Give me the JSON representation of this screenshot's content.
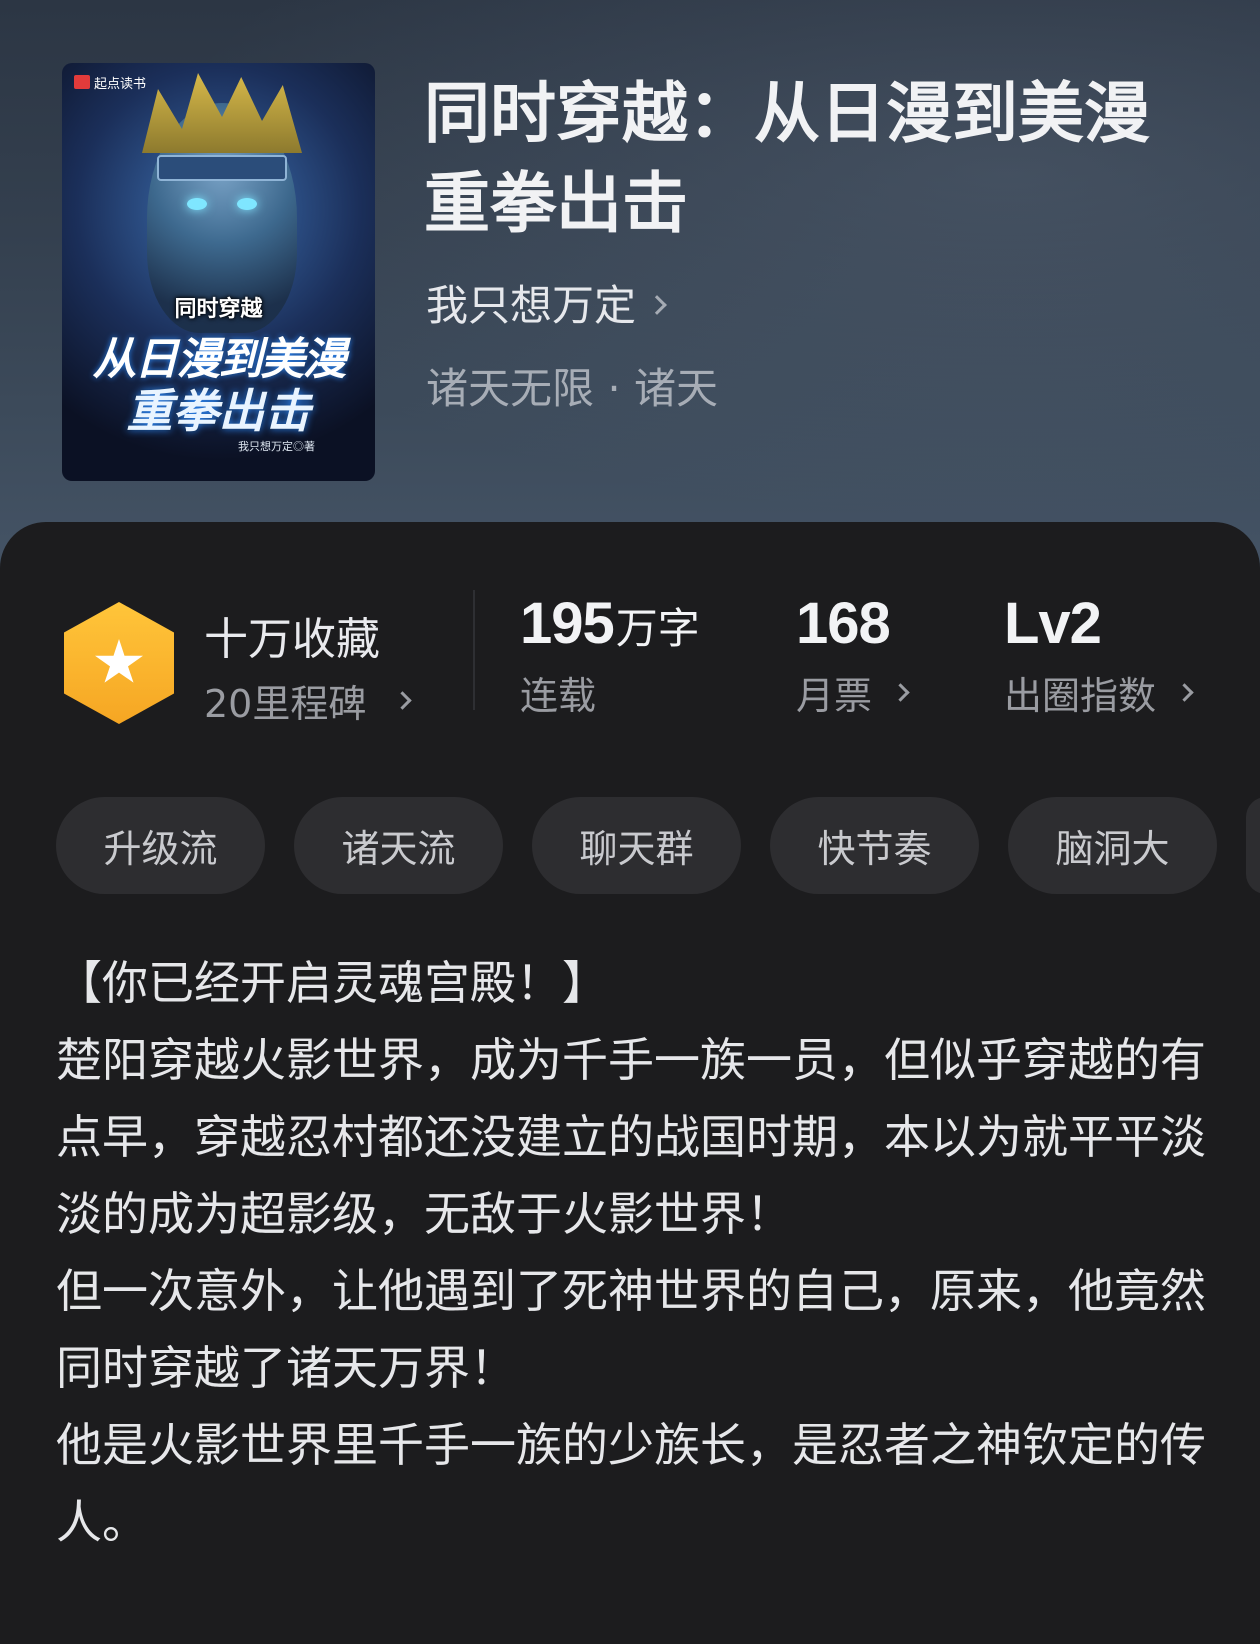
{
  "book": {
    "title": "同时穿越：从日漫到美漫重拳出击",
    "author": "我只想万定",
    "genre": "诸天无限 · 诸天",
    "cover": {
      "publisher_badge": "起点读书",
      "title_line1": "同时穿越",
      "title_line2": "从日漫到美漫",
      "title_line3": "重拳出击",
      "author_credit": "我只想万定◎著"
    }
  },
  "stats": {
    "collect_label": "十万收藏",
    "milestone_label": "20里程碑",
    "words_value": "195",
    "words_unit": "万字",
    "words_label": "连载",
    "tickets_value": "168",
    "tickets_label": "月票",
    "level_value": "Lv2",
    "level_label": "出圈指数"
  },
  "tags": [
    "升级流",
    "诸天流",
    "聊天群",
    "快节奏",
    "脑洞大"
  ],
  "description": [
    "【你已经开启灵魂宫殿！】",
    "楚阳穿越火影世界，成为千手一族一员，但似乎穿越的有点早，穿越忍村都还没建立的战国时期，本以为就平平淡淡的成为超影级，无敌于火影世界！",
    "但一次意外，让他遇到了死神世界的自己，原来，他竟然同时穿越了诸天万界！",
    "他是火影世界里千手一族的少族长，是忍者之神钦定的传人。"
  ],
  "colors": {
    "background": "#1c1c1e",
    "tag_background": "#2d2d30",
    "badge_gold": "#f6a623"
  }
}
